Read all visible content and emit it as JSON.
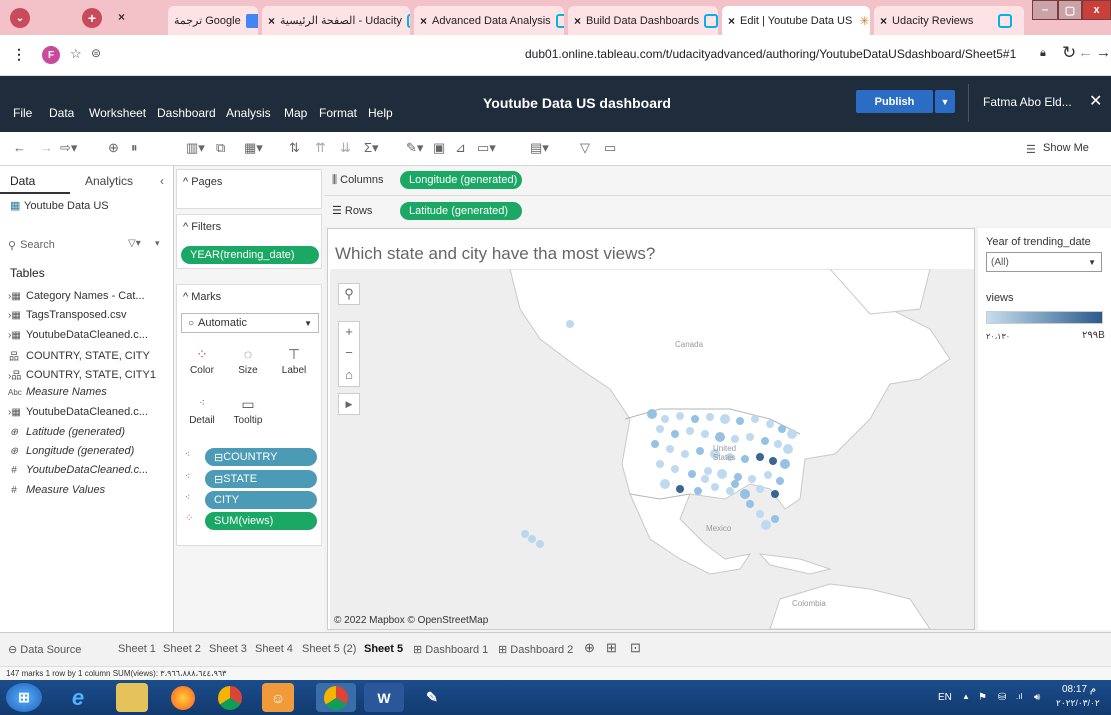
{
  "browser": {
    "tabs": [
      {
        "label": "ترجمة Google",
        "active": false
      },
      {
        "label": "الصفحة الرئيسية - Udacity",
        "active": false
      },
      {
        "label": "Advanced Data Analysis",
        "active": false
      },
      {
        "label": "Build Data Dashboards",
        "active": false
      },
      {
        "label": "Edit | Youtube Data US",
        "active": true
      },
      {
        "label": "Udacity Reviews",
        "active": false
      }
    ],
    "url": "dub01.online.tableau.com/t/udacityadvanced/authoring/YoutubeDataUSdashboard/Sheet5#1",
    "profile_initial": "F"
  },
  "tableau": {
    "menu": [
      "File",
      "Data",
      "Worksheet",
      "Dashboard",
      "Analysis",
      "Map",
      "Format",
      "Help"
    ],
    "workbook_title": "Youtube Data US dashboard",
    "publish_label": "Publish",
    "user_name": "Fatma Abo Eld...",
    "show_me": "Show Me"
  },
  "data_pane": {
    "tab_data": "Data",
    "tab_analytics": "Analytics",
    "datasource": "Youtube Data US",
    "search_placeholder": "Search",
    "tables_label": "Tables",
    "fields": [
      {
        "icon": "table",
        "label": "Category Names - Cat...",
        "italic": false
      },
      {
        "icon": "table",
        "label": "TagsTransposed.csv",
        "italic": false
      },
      {
        "icon": "table",
        "label": "YoutubeDataCleaned.c...",
        "italic": false
      },
      {
        "icon": "hierarchy",
        "label": "COUNTRY, STATE, CITY",
        "italic": false
      },
      {
        "icon": "hierarchy",
        "label": "COUNTRY, STATE, CITY1",
        "italic": false
      },
      {
        "icon": "abc",
        "label": "Measure Names",
        "italic": true
      },
      {
        "icon": "table",
        "label": "YoutubeDataCleaned.c...",
        "italic": false
      },
      {
        "icon": "globe",
        "label": "Latitude (generated)",
        "italic": true
      },
      {
        "icon": "globe",
        "label": "Longitude (generated)",
        "italic": true
      },
      {
        "icon": "hash",
        "label": "YoutubeDataCleaned.c...",
        "italic": true
      },
      {
        "icon": "hash",
        "label": "Measure Values",
        "italic": true
      }
    ]
  },
  "shelves": {
    "pages_label": "Pages",
    "filters_label": "Filters",
    "filter_pill": "YEAR(trending_date)",
    "marks_label": "Marks",
    "mark_type": "Automatic",
    "mark_buttons": [
      "Color",
      "Size",
      "Label",
      "Detail",
      "Tooltip"
    ],
    "mark_pills": [
      "COUNTRY",
      "STATE",
      "CITY",
      "SUM(views)"
    ],
    "columns_label": "Columns",
    "columns_pill": "Longitude (generated)",
    "rows_label": "Rows",
    "rows_pill": "Latitude (generated)"
  },
  "viz": {
    "title": "Which state and city have tha most views?",
    "attribution": "© 2022 Mapbox © OpenStreetMap",
    "map_labels": {
      "canada": "Canada",
      "us": "United States",
      "mexico": "Mexico",
      "colombia": "Colombia"
    }
  },
  "legend": {
    "year_title": "Year of trending_date",
    "year_value": "(All)",
    "views_title": "views",
    "views_min": "٢٠،١٣٠",
    "views_max": "٢٩٩B"
  },
  "sheet_tabs": {
    "data_source": "Data Source",
    "tabs": [
      "Sheet 1",
      "Sheet 2",
      "Sheet 3",
      "Sheet 4",
      "Sheet 5 (2)",
      "Sheet 5",
      "Dashboard 1",
      "Dashboard 2"
    ],
    "active": "Sheet 5"
  },
  "status": {
    "text": "147 marks   1 row by 1 column   SUM(views): ٣،٩٦٦،٨٨٨،٦٤٤،٩٦٣"
  },
  "taskbar": {
    "lang": "EN",
    "time": "08:17 م",
    "date": "٢٠٢٢/٠٣/٠٢"
  },
  "colors": {
    "tableau_header": "#1f2c3c",
    "publish": "#2b6cc4",
    "pill_blue": "#4c9bb6",
    "pill_green": "#1ba865",
    "active_tab": "#ffffff"
  }
}
